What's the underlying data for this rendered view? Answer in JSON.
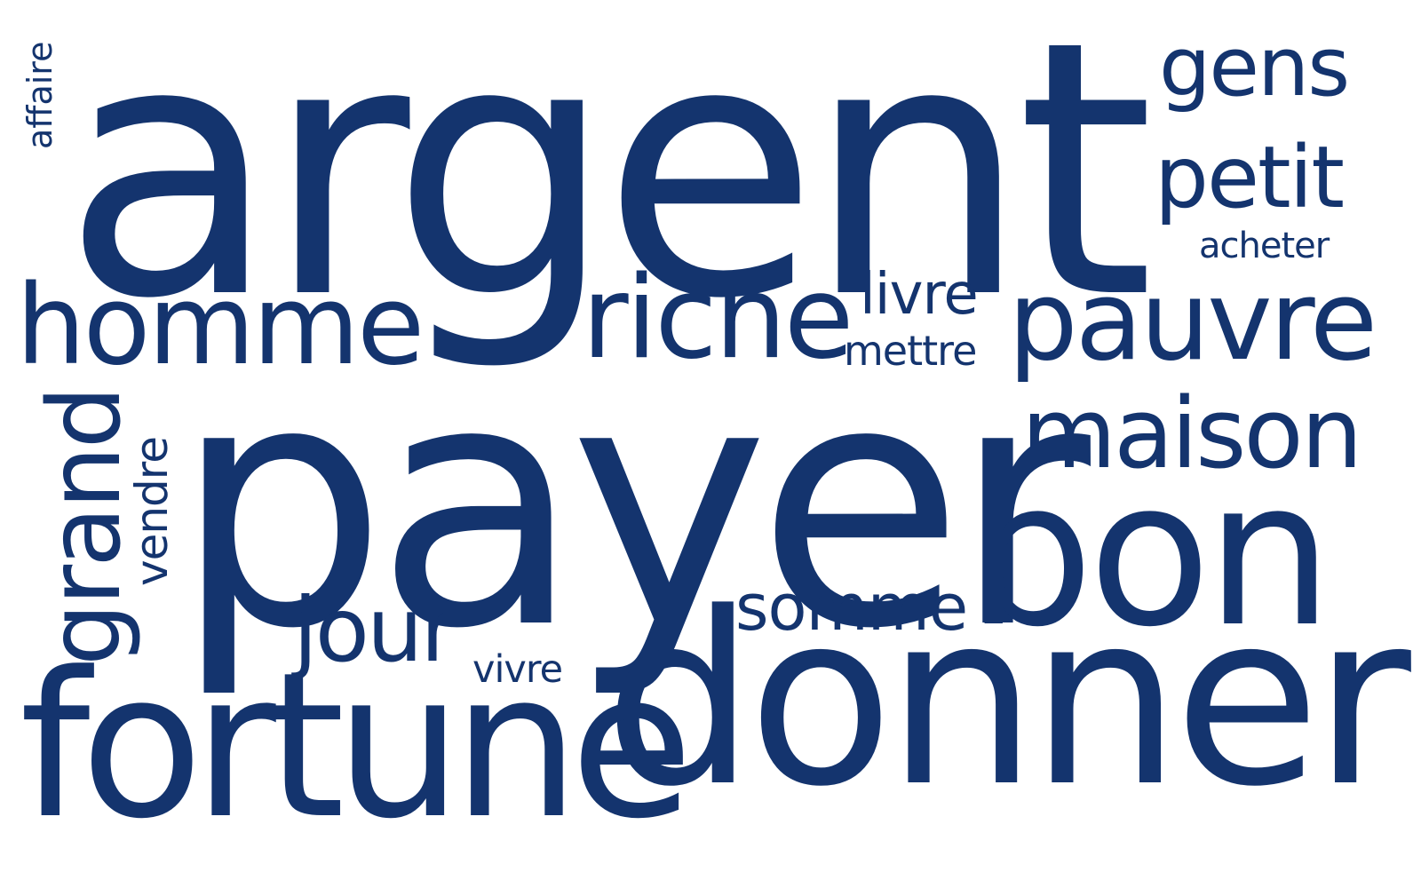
{
  "theme": {
    "word_color": "#14346e",
    "background": "#ffffff"
  },
  "words": [
    {
      "id": "argent",
      "text": "argent"
    },
    {
      "id": "payer",
      "text": "payer"
    },
    {
      "id": "donner",
      "text": "donner"
    },
    {
      "id": "fortune",
      "text": "fortune"
    },
    {
      "id": "bon",
      "text": "bon"
    },
    {
      "id": "pauvre",
      "text": "pauvre"
    },
    {
      "id": "riche",
      "text": "riche"
    },
    {
      "id": "homme",
      "text": "homme"
    },
    {
      "id": "maison",
      "text": "maison"
    },
    {
      "id": "jour",
      "text": "jour"
    },
    {
      "id": "gens",
      "text": "gens"
    },
    {
      "id": "petit",
      "text": "petit"
    },
    {
      "id": "somme",
      "text": "somme"
    },
    {
      "id": "livre",
      "text": "livre"
    },
    {
      "id": "mettre",
      "text": "mettre"
    },
    {
      "id": "acheter",
      "text": "acheter"
    },
    {
      "id": "vivre",
      "text": "vivre"
    },
    {
      "id": "affaire",
      "text": "affaire"
    },
    {
      "id": "grand",
      "text": "grand"
    },
    {
      "id": "vendre",
      "text": "vendre"
    }
  ]
}
